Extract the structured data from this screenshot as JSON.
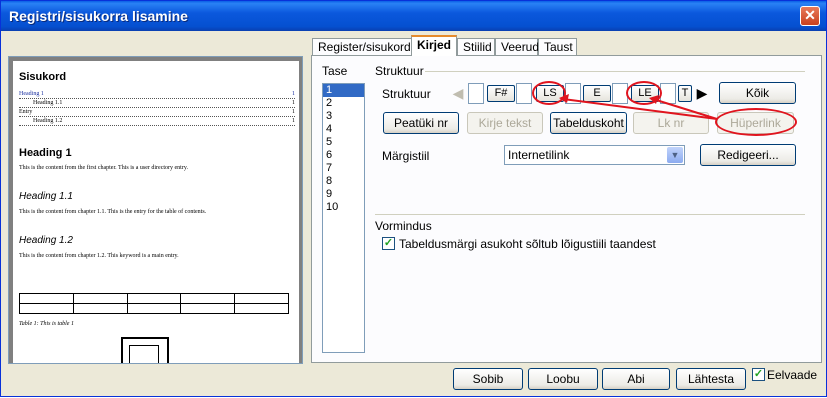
{
  "window": {
    "title": "Registri/sisukorra lisamine",
    "close_icon": "close-icon"
  },
  "tabs": [
    "Register/sisukord",
    "Kirjed",
    "Stiilid",
    "Veerud",
    "Taust"
  ],
  "preview": {
    "toc_title": "Sisukord",
    "toc_entries": [
      {
        "text": "Heading 1",
        "page": "1"
      },
      {
        "text": "Heading 1.1",
        "page": "1"
      },
      {
        "text": "Entry",
        "page": "1"
      },
      {
        "text": "Heading 1.2",
        "page": "1"
      }
    ],
    "h1": "Heading 1",
    "p1": "This is the content from the first chapter. This is a user directory entry.",
    "h11": "Heading 1.1",
    "p2": "This is the content from chapter 1.1. This is the entry for the table of contents.",
    "h12": "Heading 1.2",
    "p3": "This is the content from chapter 1.2. This keyword is a main entry.",
    "table_caption": "Table 1: This is table 1"
  },
  "level": {
    "label": "Tase",
    "items": [
      "1",
      "2",
      "3",
      "4",
      "5",
      "6",
      "7",
      "8",
      "9",
      "10"
    ],
    "selected": "1"
  },
  "structure": {
    "group_label": "Struktuur",
    "row_label": "Struktuur",
    "tokens": [
      "F#",
      "LS",
      "E",
      "LE",
      "T"
    ],
    "all_button": "Kõik"
  },
  "buttons": {
    "chapter_no": "Peatüki nr",
    "entry_text": "Kirje tekst",
    "tab_stop": "Tabelduskoht",
    "page_no": "Lk nr",
    "hyperlink": "Hüperlink"
  },
  "char_style": {
    "label": "Märgistiil",
    "value": "Internetilink",
    "edit_button": "Redigeeri..."
  },
  "format": {
    "group_label": "Vormindus",
    "tab_rel_label": "Tabeldusmärgi asukoht sõltub lõigustiili taandest",
    "tab_rel_checked": true
  },
  "footer": {
    "ok": "Sobib",
    "cancel": "Loobu",
    "help": "Abi",
    "reset": "Lähtesta",
    "preview_label": "Eelvaade",
    "preview_checked": true
  },
  "colors": {
    "title_bar": "#0550d0",
    "annotation": "#e0141e",
    "selection": "#316ac5"
  }
}
